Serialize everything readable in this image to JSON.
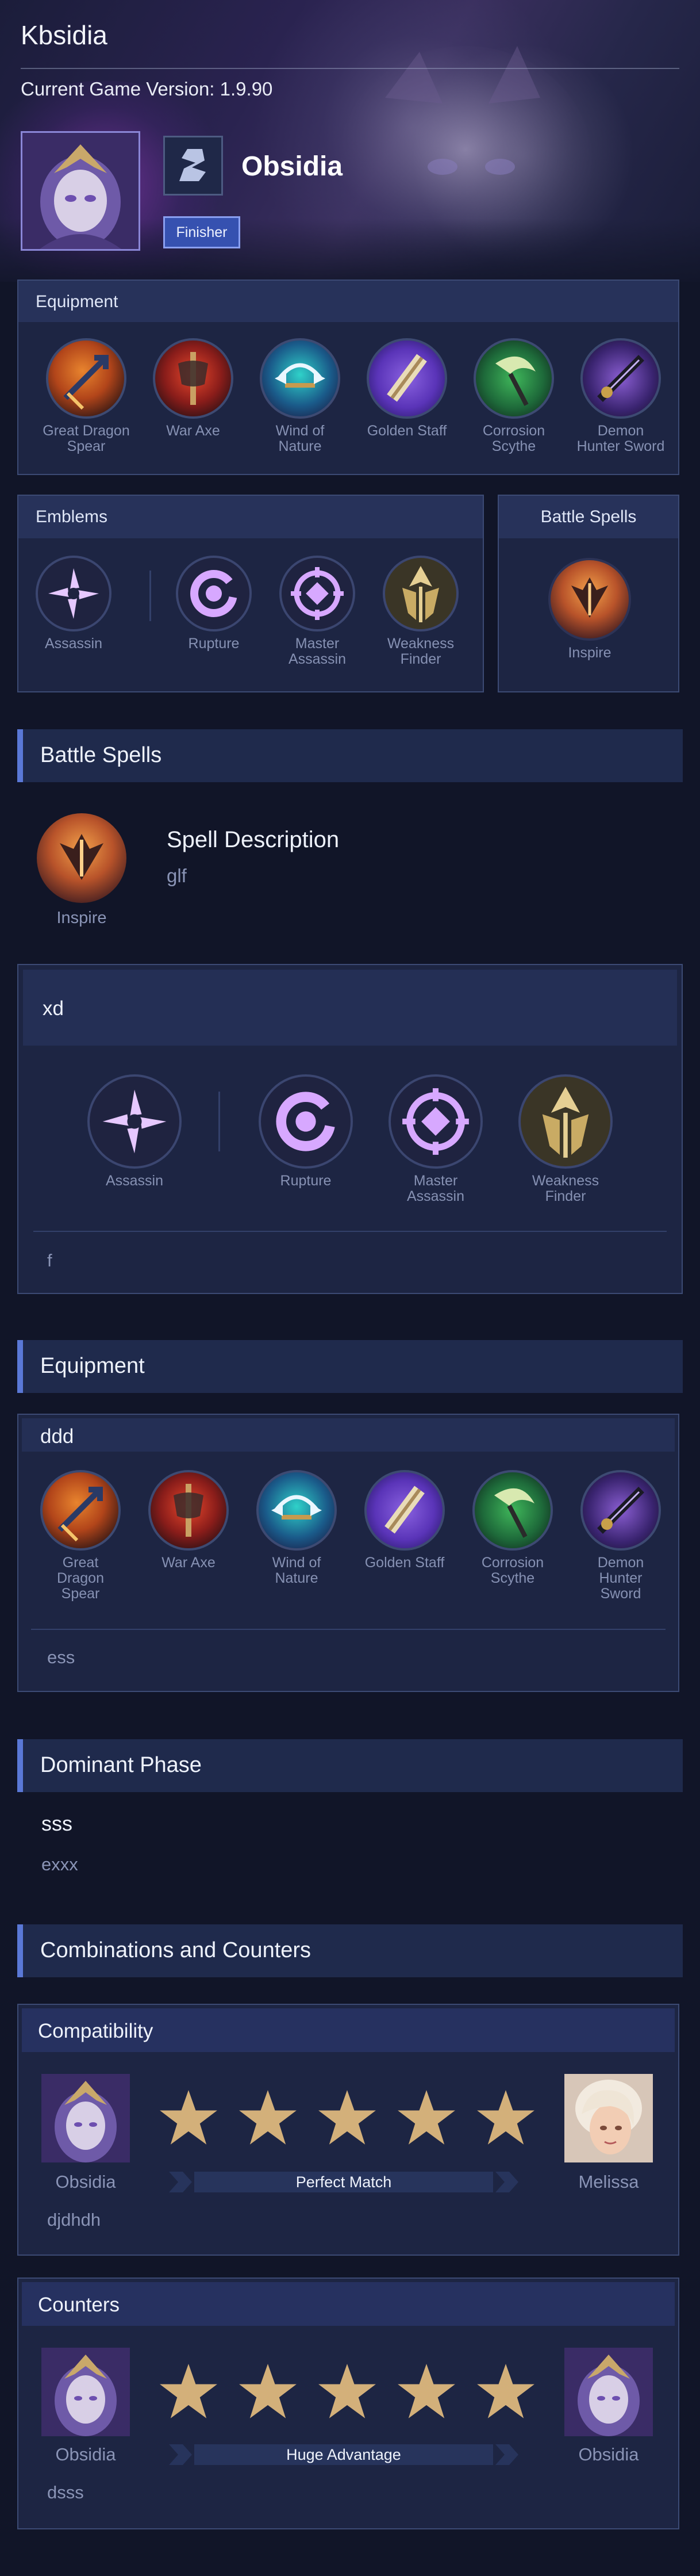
{
  "site": {
    "title": "Kbsidia",
    "version_text": "Current Game Version: 1.9.90"
  },
  "hero": {
    "name": "Obsidia",
    "tag": "Finisher",
    "role_icon": "assassin-s-icon"
  },
  "equipment_card": {
    "title": "Equipment",
    "items": [
      {
        "name": "Great Dragon Spear",
        "icon": "great-dragon-spear-icon"
      },
      {
        "name": "War Axe",
        "icon": "war-axe-icon"
      },
      {
        "name": "Wind of Nature",
        "icon": "wind-of-nature-icon"
      },
      {
        "name": "Golden Staff",
        "icon": "golden-staff-icon"
      },
      {
        "name": "Corrosion Scythe",
        "icon": "corrosion-scythe-icon"
      },
      {
        "name": "Demon Hunter Sword",
        "icon": "demon-hunter-sword-icon"
      }
    ]
  },
  "emblems_card": {
    "title": "Emblems",
    "main": {
      "name": "Assassin"
    },
    "talents": [
      {
        "name": "Rupture"
      },
      {
        "name": "Master Assassin"
      },
      {
        "name": "Weakness Finder"
      }
    ]
  },
  "battle_spell_card": {
    "title": "Battle Spells",
    "spell": {
      "name": "Inspire"
    }
  },
  "battle_spells_section": {
    "header": "Battle Spells",
    "spell_name": "Inspire",
    "description_title": "Spell Description",
    "description_text": "glf"
  },
  "emblem_build": {
    "title": "xd",
    "main": {
      "name": "Assassin"
    },
    "talents": [
      {
        "name": "Rupture"
      },
      {
        "name": "Master Assassin"
      },
      {
        "name": "Weakness Finder"
      }
    ],
    "note": "f"
  },
  "equipment_section": {
    "header": "Equipment",
    "build_title": "ddd",
    "items": [
      {
        "name": "Great Dragon Spear"
      },
      {
        "name": "War Axe"
      },
      {
        "name": "Wind of Nature"
      },
      {
        "name": "Golden Staff"
      },
      {
        "name": "Corrosion Scythe"
      },
      {
        "name": "Demon Hunter Sword"
      }
    ],
    "note": "ess"
  },
  "dominant_phase": {
    "header": "Dominant Phase",
    "title": "sss",
    "text": "exxx"
  },
  "combos": {
    "header": "Combinations and Counters",
    "compatibility": {
      "title": "Compatibility",
      "left_hero": "Obsidia",
      "right_hero": "Melissa",
      "rating_stars": 5,
      "rating_label": "Perfect Match",
      "note": "djdhdh"
    },
    "counters": {
      "title": "Counters",
      "left_hero": "Obsidia",
      "right_hero": "Obsidia",
      "rating_stars": 5,
      "rating_label": "Huge Advantage",
      "note": "dsss"
    }
  },
  "colors": {
    "background": "#111528",
    "panel": "#1d2543",
    "panel_header": "#27325a",
    "accent": "#5a78d6",
    "tag_fill": "#3651b0",
    "star": "#d3b07a"
  }
}
